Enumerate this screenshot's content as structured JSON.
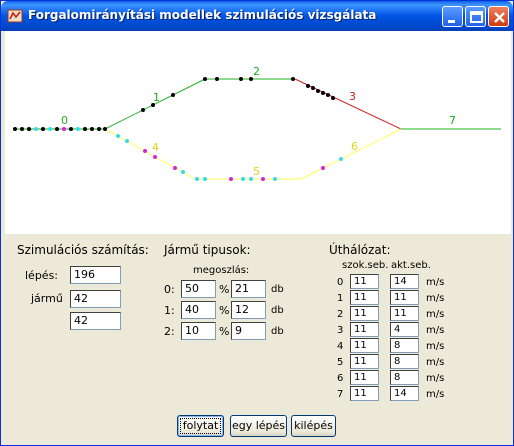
{
  "window": {
    "title": "Forgalomirányítási modellek szimulációs vizsgálata"
  },
  "track": {
    "segment_labels": [
      "0",
      "1",
      "2",
      "3",
      "4",
      "5",
      "6",
      "7"
    ],
    "colors": {
      "green": "#22b522",
      "red": "#cc2222",
      "yellow": "#ffff55",
      "label_green": "#22aa22",
      "label_red": "#cc2222",
      "label_yellow": "#e8d020",
      "vehicle_black": "#000000",
      "vehicle_cyan": "#33ddee",
      "vehicle_magenta": "#dd22dd"
    }
  },
  "simulation": {
    "heading": "Szimulációs számítás:",
    "step_label": "lépés:",
    "step_value": "196",
    "vehicle_label": "jármű",
    "vehicle_value": "42",
    "vehicle_value2": "42"
  },
  "vehicle_types": {
    "heading": "Jármű tipusok:",
    "subheading": "megoszlás:",
    "rows": [
      {
        "index": "0:",
        "percent": "50",
        "pct_sign": "%",
        "count": "21",
        "unit": "db"
      },
      {
        "index": "1:",
        "percent": "40",
        "pct_sign": "%",
        "count": "12",
        "unit": "db"
      },
      {
        "index": "2:",
        "percent": "10",
        "pct_sign": "%",
        "count": "9",
        "unit": "db"
      }
    ]
  },
  "route": {
    "heading": "Úthálózat:",
    "col_free": "szok.seb.",
    "col_current": "akt.seb.",
    "rows": [
      {
        "index": "0",
        "free": "11",
        "current": "14",
        "unit": "m/s"
      },
      {
        "index": "1",
        "free": "11",
        "current": "11",
        "unit": "m/s"
      },
      {
        "index": "2",
        "free": "11",
        "current": "11",
        "unit": "m/s"
      },
      {
        "index": "3",
        "free": "11",
        "current": "4",
        "unit": "m/s"
      },
      {
        "index": "4",
        "free": "11",
        "current": "8",
        "unit": "m/s"
      },
      {
        "index": "5",
        "free": "11",
        "current": "8",
        "unit": "m/s"
      },
      {
        "index": "6",
        "free": "11",
        "current": "8",
        "unit": "m/s"
      },
      {
        "index": "7",
        "free": "11",
        "current": "14",
        "unit": "m/s"
      }
    ]
  },
  "buttons": {
    "continue": "folytat",
    "one_step": "egy lépés",
    "exit": "kilépés"
  }
}
